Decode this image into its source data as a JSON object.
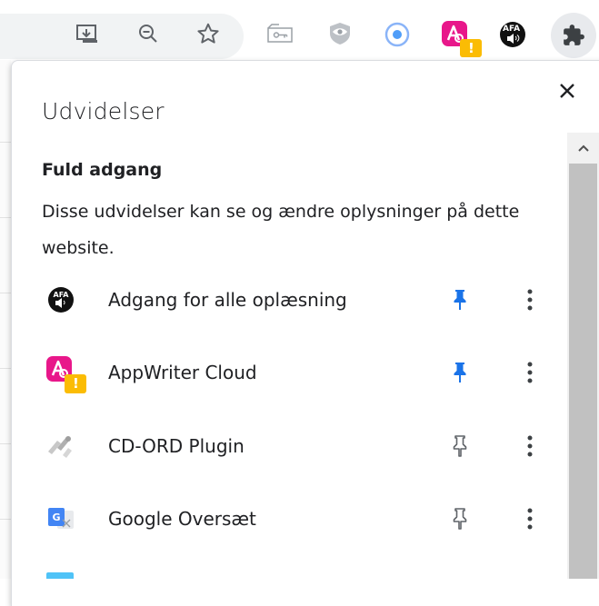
{
  "toolbar": {
    "icons": [
      "install-app-icon",
      "zoom-out-icon",
      "bookmark-star-icon",
      "password-key-icon",
      "privacy-eye-icon",
      "record-icon",
      "appwriter-icon",
      "afa-reader-icon",
      "extensions-puzzle-icon"
    ],
    "badge": "!",
    "afa_label": "AFA"
  },
  "popup": {
    "title": "Udvidelser",
    "close_icon": "close-icon",
    "section_heading": "Fuld adgang",
    "section_description": "Disse udvidelser kan se og ændre oplysninger på dette website."
  },
  "extensions": [
    {
      "name": "Adgang for alle oplæsning",
      "icon": "afa-icon",
      "pinned": true
    },
    {
      "name": "AppWriter Cloud",
      "icon": "appwriter-icon",
      "pinned": true
    },
    {
      "name": "CD-ORD Plugin",
      "icon": "cd-ord-icon",
      "pinned": false
    },
    {
      "name": "Google Oversæt",
      "icon": "google-translate-icon",
      "pinned": false
    }
  ],
  "colors": {
    "pin_active": "#1a73e8",
    "pin_inactive": "#5f6368",
    "appwriter_pink": "#e8178a",
    "badge_yellow": "#fbbc04",
    "scroll_thumb": "#c1c1c1"
  }
}
